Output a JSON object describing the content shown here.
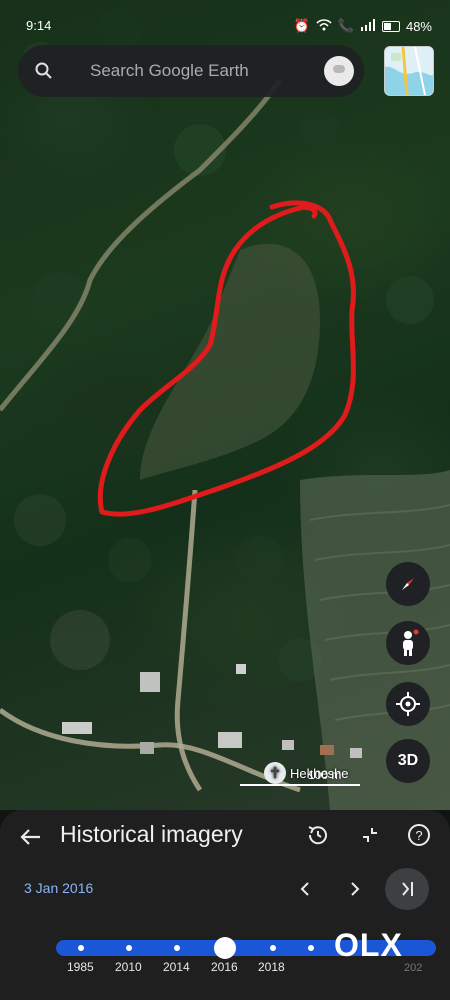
{
  "status": {
    "time": "9:14",
    "battery": "48%"
  },
  "search": {
    "placeholder": "Search Google Earth"
  },
  "map": {
    "place_label": "Hekheshe",
    "scale_label": "100 m"
  },
  "controls": {
    "btn_3d": "3D"
  },
  "panel": {
    "title": "Historical imagery",
    "date": "3 Jan 2016",
    "years": [
      "1985",
      "2010",
      "2014",
      "2016",
      "2018"
    ],
    "year_end_partial": "202",
    "selected_year": "2016"
  },
  "watermark": {
    "text": "OLX"
  },
  "colors": {
    "annotation": "#e01b1b",
    "timeline": "#1a56d6",
    "accent_date": "#8ab4f8"
  }
}
